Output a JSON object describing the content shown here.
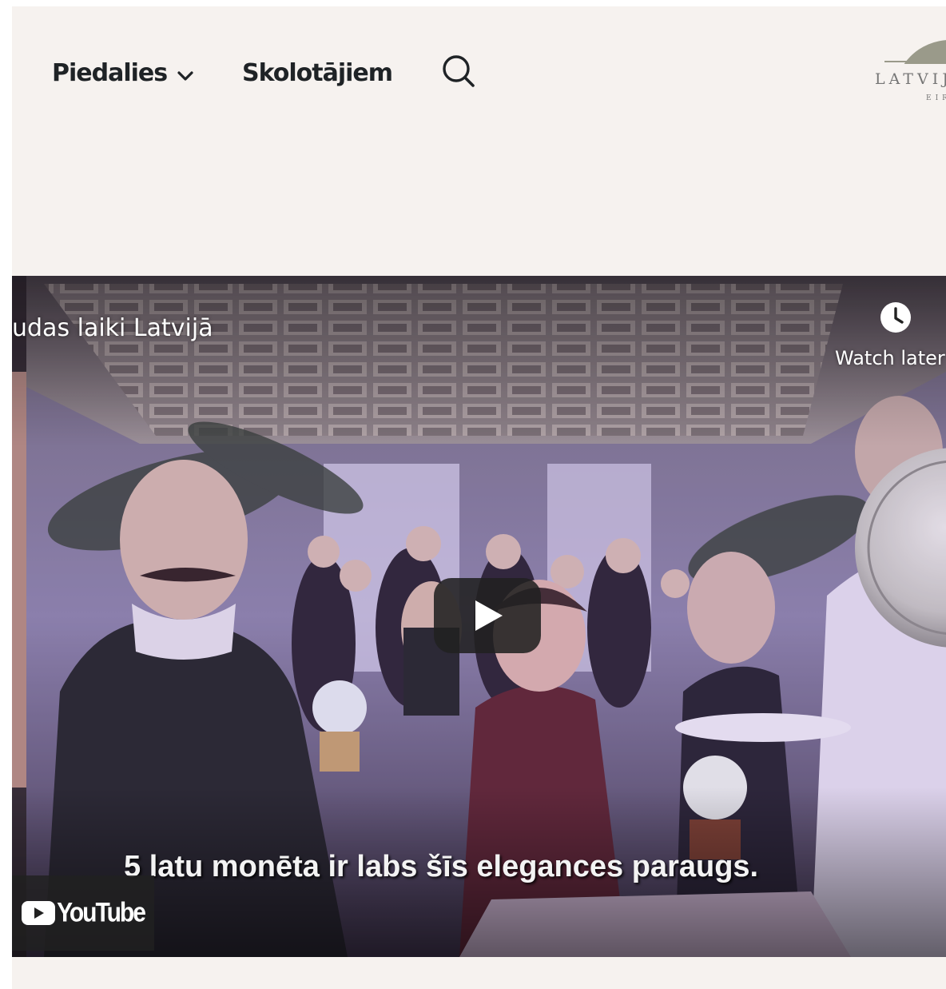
{
  "header": {
    "nav": [
      {
        "label": "Piedalies",
        "has_dropdown": true
      },
      {
        "label": "Skolotājiem",
        "has_dropdown": false
      }
    ],
    "search_icon": "search-icon",
    "logo": {
      "text": "LATVIJ",
      "subtext": "EIR"
    }
  },
  "video": {
    "title": "udas laiki Latvijā",
    "watch_later_label": "Watch later",
    "watch_later_icon": "clock-icon",
    "play_icon": "play-icon",
    "subtitle": "5 latu monēta ir labs šīs elegances paraugs.",
    "platform_label": "YouTube"
  },
  "colors": {
    "page_background": "#f6f2ef",
    "nav_text": "#1f2326",
    "logo_color": "#9a9a8a"
  }
}
